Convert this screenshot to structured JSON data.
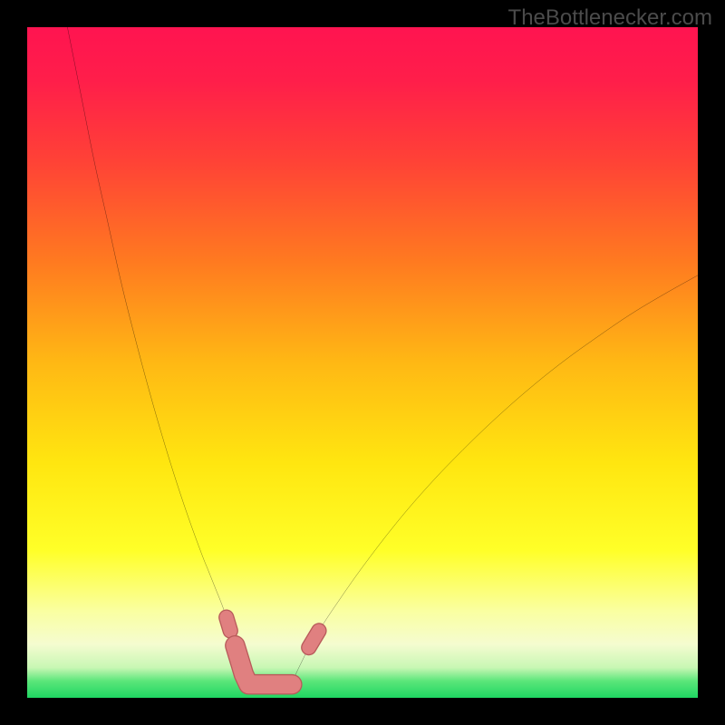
{
  "watermark": "TheBottlenecker.com",
  "colors": {
    "frame": "#000000",
    "curve": "#000000",
    "marker_fill": "#e08080",
    "marker_stroke": "#b85a5a"
  },
  "gradient_stops": [
    {
      "pct": 0.0,
      "color": "#ff1450"
    },
    {
      "pct": 0.08,
      "color": "#ff1e4a"
    },
    {
      "pct": 0.2,
      "color": "#ff4236"
    },
    {
      "pct": 0.35,
      "color": "#ff7a20"
    },
    {
      "pct": 0.5,
      "color": "#ffb814"
    },
    {
      "pct": 0.65,
      "color": "#ffe610"
    },
    {
      "pct": 0.78,
      "color": "#ffff28"
    },
    {
      "pct": 0.87,
      "color": "#faffa0"
    },
    {
      "pct": 0.92,
      "color": "#f5fcd0"
    },
    {
      "pct": 0.955,
      "color": "#c8f7b4"
    },
    {
      "pct": 0.975,
      "color": "#5be67a"
    },
    {
      "pct": 1.0,
      "color": "#1fd662"
    }
  ],
  "chart_data": {
    "type": "line",
    "title": "",
    "xlabel": "",
    "ylabel": "",
    "xlim": [
      0,
      100
    ],
    "ylim": [
      0,
      100
    ],
    "series": [
      {
        "name": "left-curve",
        "x": [
          6,
          8,
          10,
          12,
          14,
          16,
          18,
          20,
          22,
          24,
          26,
          27,
          28,
          29,
          29.7,
          30.3,
          31,
          31.7,
          32.3,
          33
        ],
        "values": [
          100,
          90,
          80,
          71,
          62,
          54,
          46.5,
          39.5,
          33,
          27,
          21.5,
          19,
          16.5,
          14,
          12,
          10,
          7.8,
          5.5,
          3.5,
          2
        ]
      },
      {
        "name": "right-curve",
        "x": [
          39.5,
          40,
          41,
          42,
          43.5,
          46,
          50,
          55,
          60,
          65,
          70,
          75,
          80,
          85,
          90,
          95,
          100
        ],
        "values": [
          2,
          3.4,
          5.5,
          7.5,
          10,
          13.8,
          19.5,
          26,
          31.8,
          37,
          41.8,
          46.2,
          50.2,
          53.8,
          57.2,
          60.2,
          63
        ]
      }
    ],
    "flat_segment": {
      "x": [
        33,
        39.5
      ],
      "y": 2
    },
    "markers": {
      "left_short": {
        "x": [
          29.7,
          30.3
        ],
        "y": [
          12,
          10
        ]
      },
      "left_long": {
        "x": [
          31,
          31.7,
          32.3,
          33,
          33.7,
          34.7,
          35.8,
          37,
          38.2,
          39.5
        ],
        "y": [
          7.8,
          5.5,
          3.5,
          2,
          2,
          2,
          2,
          2,
          2,
          2
        ]
      },
      "right_a": {
        "x": [
          42,
          43.5
        ],
        "y": [
          7.5,
          10
        ]
      },
      "right_b": {
        "x": [
          46
        ],
        "y": [
          13.8
        ]
      }
    }
  }
}
